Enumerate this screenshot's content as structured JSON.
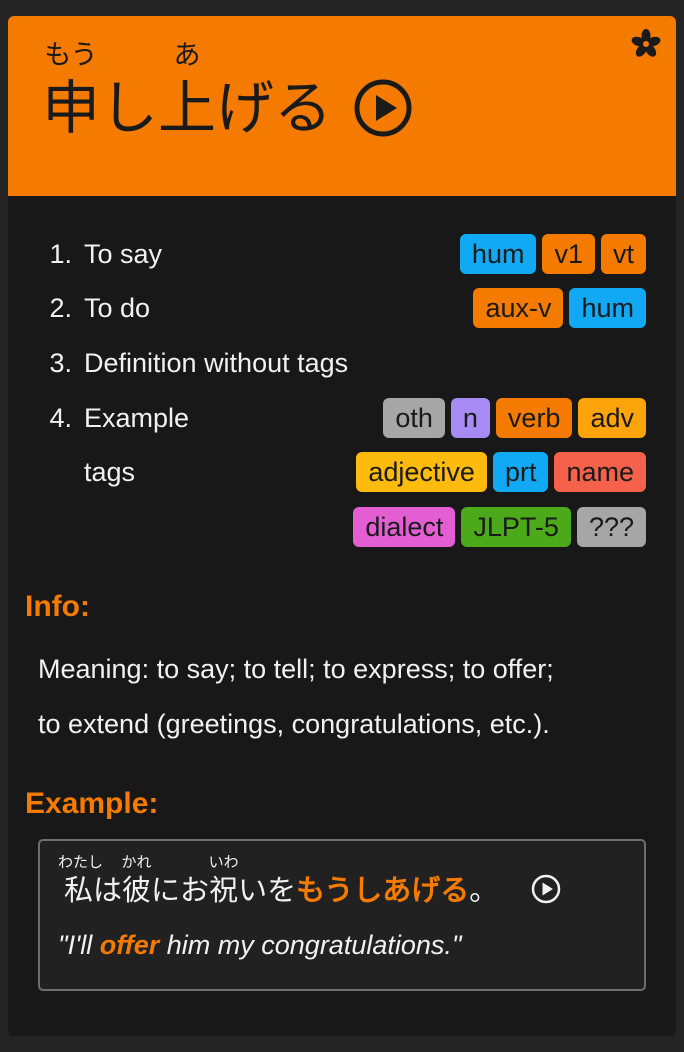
{
  "header": {
    "word": [
      {
        "kanji": "申",
        "reading": "もう"
      },
      {
        "kanji": "し",
        "reading": ""
      },
      {
        "kanji": "上",
        "reading": "あ"
      },
      {
        "kanji": "げる",
        "reading": ""
      }
    ],
    "background_color": "#f57b00",
    "corner_icon": "flower-icon",
    "play_icon": "play-circle-icon"
  },
  "definitions": [
    {
      "num": "1.",
      "text": "To say",
      "tags": [
        {
          "label": "hum",
          "color": "#11a9f3"
        },
        {
          "label": "v1",
          "color": "#f57b00"
        },
        {
          "label": "vt",
          "color": "#f57b00"
        }
      ]
    },
    {
      "num": "2.",
      "text": "To do",
      "tags": [
        {
          "label": "aux-v",
          "color": "#f57b00"
        },
        {
          "label": "hum",
          "color": "#11a9f3"
        }
      ]
    },
    {
      "num": "3.",
      "text": "Definition without tags",
      "tags": []
    },
    {
      "num": "4.",
      "text": "Example",
      "text2": "tags",
      "tags": [
        {
          "label": "oth",
          "color": "#a6a6a6"
        },
        {
          "label": "n",
          "color": "#a68bf5"
        },
        {
          "label": "verb",
          "color": "#f57b00"
        },
        {
          "label": "adv",
          "color": "#fca40a"
        }
      ],
      "tags2": [
        {
          "label": "adjective",
          "color": "#fcbb0d"
        },
        {
          "label": "prt",
          "color": "#11a9f3"
        },
        {
          "label": "name",
          "color": "#f5614a"
        }
      ],
      "tags3": [
        {
          "label": "dialect",
          "color": "#e45ed3"
        },
        {
          "label": "JLPT-5",
          "color": "#4caa1a"
        },
        {
          "label": "???",
          "color": "#a6a6a6"
        }
      ]
    }
  ],
  "info": {
    "title": "Info:",
    "line1": "Meaning: to say; to tell; to express; to offer;",
    "line2": "to extend (greetings, congratulations, etc.)."
  },
  "example": {
    "title": "Example:",
    "jp_parts": [
      {
        "text": "私",
        "reading": "わたし"
      },
      {
        "text": "は",
        "reading": ""
      },
      {
        "text": "彼",
        "reading": "かれ"
      },
      {
        "text": "にお",
        "reading": ""
      },
      {
        "text": "祝",
        "reading": "いわ"
      },
      {
        "text": "いを",
        "reading": ""
      }
    ],
    "jp_highlight": "もうしあげる",
    "jp_end": "。",
    "en_before": "\"I'll ",
    "en_highlight": "offer",
    "en_after": " him my congratulations.\""
  }
}
